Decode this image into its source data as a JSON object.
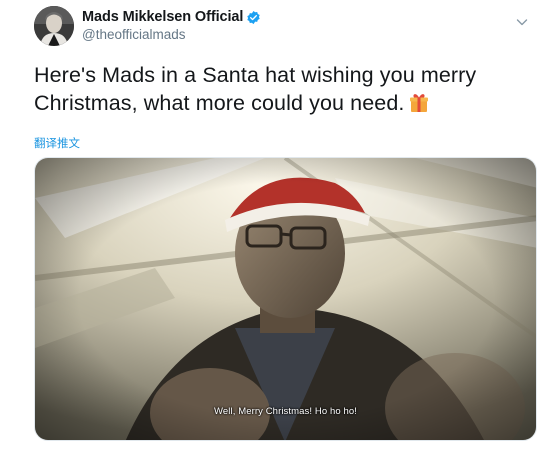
{
  "author": {
    "display_name": "Mads Mikkelsen Official",
    "handle": "@theofficialmads",
    "verified": true
  },
  "tweet": {
    "text": "Here's Mads in a Santa hat wishing you merry Christmas, what more could you need.",
    "emoji": "gift-emoji"
  },
  "translate": {
    "label": "翻译推文"
  },
  "media": {
    "subtitle": "Well, Merry Christmas! Ho ho ho!"
  },
  "colors": {
    "link": "#1b95e0",
    "verified": "#1da1f2",
    "secondary_text": "#657786"
  }
}
